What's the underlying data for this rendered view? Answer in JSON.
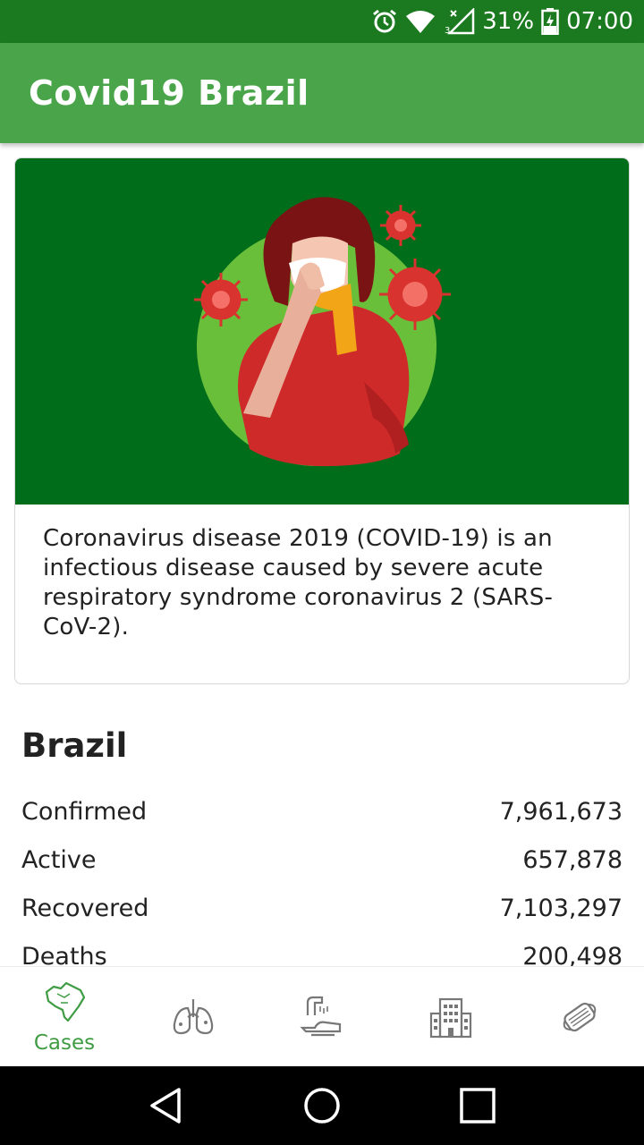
{
  "status_bar": {
    "battery": "31%",
    "time": "07:00"
  },
  "app_bar": {
    "title": "Covid19 Brazil"
  },
  "info_card": {
    "description": "Coronavirus disease 2019 (COVID-19) is an infectious disease caused by severe acute respiratory syndrome coronavirus 2 (SARS-CoV-2)."
  },
  "stats_section": {
    "title": "Brazil",
    "rows": [
      {
        "label": "Confirmed",
        "value": "7,961,673"
      },
      {
        "label": "Active",
        "value": "657,878"
      },
      {
        "label": "Recovered",
        "value": "7,103,297"
      },
      {
        "label": "Deaths",
        "value": "200,498"
      }
    ]
  },
  "bottom_nav": {
    "items": [
      {
        "label": "Cases",
        "icon": "brazil-map-icon",
        "active": true
      },
      {
        "label": "",
        "icon": "lungs-icon",
        "active": false
      },
      {
        "label": "",
        "icon": "handwash-icon",
        "active": false
      },
      {
        "label": "",
        "icon": "hospital-icon",
        "active": false
      },
      {
        "label": "",
        "icon": "face-mask-icon",
        "active": false
      }
    ]
  },
  "colors": {
    "status_bar": "#1b7a1f",
    "app_bar": "#4aa54a",
    "hero_background": "#006d1b",
    "accent": "#3f9c43"
  }
}
